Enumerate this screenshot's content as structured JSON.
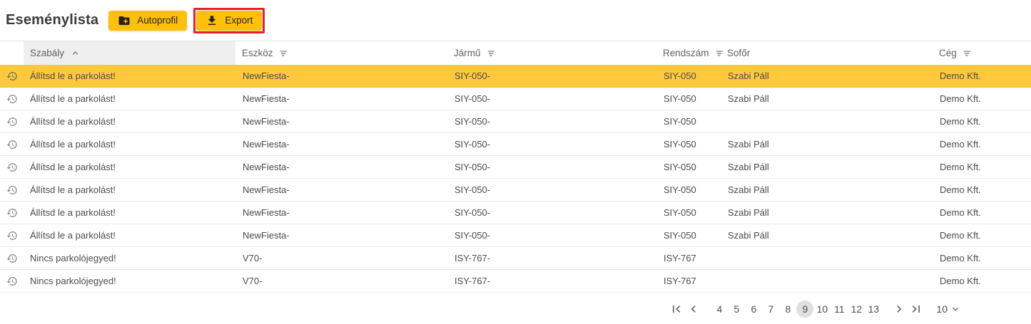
{
  "header": {
    "title": "Eseménylista",
    "autoprofil_button": {
      "label": "Autoprofil",
      "icon": "create-new-folder-icon"
    },
    "export_button": {
      "label": "Export",
      "icon": "download-icon",
      "annotated": true
    }
  },
  "colors": {
    "button_bg": "#FFC107",
    "selected_row_bg": "#FFC83D",
    "annotation_red": "#E8202A",
    "sorted_header_bg": "#EFEFEF",
    "current_page_bg": "#E0E0E0"
  },
  "table": {
    "columns": [
      {
        "label": "Szabály",
        "sort": "asc"
      },
      {
        "label": "Eszköz",
        "sort": "sortable"
      },
      {
        "label": "Jármű",
        "sort": "sortable"
      },
      {
        "label": "Rendszám",
        "sort": "sortable"
      },
      {
        "label": "Sofőr",
        "sort": "none"
      },
      {
        "label": "Cég",
        "sort": "sortable"
      }
    ],
    "row_icon": "history-icon",
    "rows": [
      {
        "szabaly": "Állítsd le a parkolást!",
        "eszkoz": "NewFiesta-",
        "jarmu": "SIY-050-",
        "rendszam": "SIY-050",
        "sofor": "Szabi Páll",
        "ceg": "Demo Kft.",
        "selected": true
      },
      {
        "szabaly": "Állítsd le a parkolást!",
        "eszkoz": "NewFiesta-",
        "jarmu": "SIY-050-",
        "rendszam": "SIY-050",
        "sofor": "Szabi Páll",
        "ceg": "Demo Kft.",
        "selected": false
      },
      {
        "szabaly": "Állítsd le a parkolást!",
        "eszkoz": "NewFiesta-",
        "jarmu": "SIY-050-",
        "rendszam": "SIY-050",
        "sofor": "",
        "ceg": "Demo Kft.",
        "selected": false
      },
      {
        "szabaly": "Állítsd le a parkolást!",
        "eszkoz": "NewFiesta-",
        "jarmu": "SIY-050-",
        "rendszam": "SIY-050",
        "sofor": "Szabi Páll",
        "ceg": "Demo Kft.",
        "selected": false
      },
      {
        "szabaly": "Állítsd le a parkolást!",
        "eszkoz": "NewFiesta-",
        "jarmu": "SIY-050-",
        "rendszam": "SIY-050",
        "sofor": "Szabi Páll",
        "ceg": "Demo Kft.",
        "selected": false
      },
      {
        "szabaly": "Állítsd le a parkolást!",
        "eszkoz": "NewFiesta-",
        "jarmu": "SIY-050-",
        "rendszam": "SIY-050",
        "sofor": "Szabi Páll",
        "ceg": "Demo Kft.",
        "selected": false
      },
      {
        "szabaly": "Állítsd le a parkolást!",
        "eszkoz": "NewFiesta-",
        "jarmu": "SIY-050-",
        "rendszam": "SIY-050",
        "sofor": "Szabi Páll",
        "ceg": "Demo Kft.",
        "selected": false
      },
      {
        "szabaly": "Állítsd le a parkolást!",
        "eszkoz": "NewFiesta-",
        "jarmu": "SIY-050-",
        "rendszam": "SIY-050",
        "sofor": "Szabi Páll",
        "ceg": "Demo Kft.",
        "selected": false
      },
      {
        "szabaly": "Nincs parkolójegyed!",
        "eszkoz": "V70-",
        "jarmu": "ISY-767-",
        "rendszam": "ISY-767",
        "sofor": "",
        "ceg": "Demo Kft.",
        "selected": false
      },
      {
        "szabaly": "Nincs parkolójegyed!",
        "eszkoz": "V70-",
        "jarmu": "ISY-767-",
        "rendszam": "ISY-767",
        "sofor": "",
        "ceg": "Demo Kft.",
        "selected": false
      }
    ]
  },
  "pagination": {
    "pages": [
      "4",
      "5",
      "6",
      "7",
      "8",
      "9",
      "10",
      "11",
      "12",
      "13"
    ],
    "current": "9",
    "page_size": "10"
  }
}
